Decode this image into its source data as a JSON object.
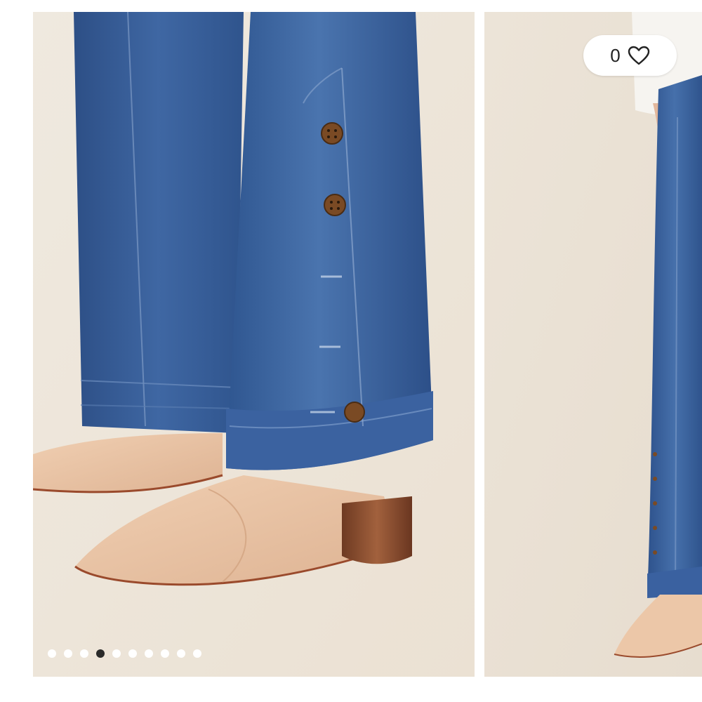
{
  "wishlist": {
    "count": "0",
    "icon": "heart-icon"
  },
  "carousel": {
    "slide_count": 10,
    "active_index": 3
  },
  "colors": {
    "background": "#efe8dc",
    "denim": "#3a5f98",
    "shoe": "#e9c4a4",
    "heel": "#8a4a2a",
    "active_dot": "#2a2a2a",
    "inactive_dot": "#ffffff"
  }
}
